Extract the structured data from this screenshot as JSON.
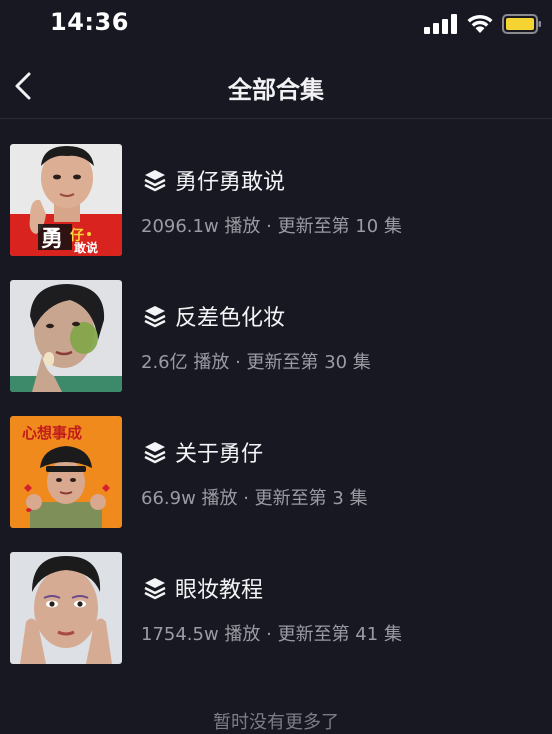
{
  "status_bar": {
    "time": "14:36",
    "icons": [
      "signal-icon",
      "wifi-icon",
      "battery-icon"
    ],
    "battery_color": "#f5d431"
  },
  "header": {
    "back_icon": "chevron-left-icon",
    "title": "全部合集"
  },
  "collections": [
    {
      "title": "勇仔勇敢说",
      "meta": "2096.1w 播放 · 更新至第 10 集",
      "thumb_text": "勇仔 敢说"
    },
    {
      "title": "反差色化妆",
      "meta": "2.6亿 播放 · 更新至第 30 集"
    },
    {
      "title": "关于勇仔",
      "meta": "66.9w 播放 · 更新至第 3 集",
      "thumb_text": "心想事成"
    },
    {
      "title": "眼妆教程",
      "meta": "1754.5w 播放 · 更新至第 41 集"
    }
  ],
  "footer": {
    "text": "暂时没有更多了"
  },
  "colors": {
    "background": "#171821",
    "text_primary": "#f4f4f6",
    "text_secondary": "#9a9ba3",
    "divider": "#2a2b34"
  }
}
